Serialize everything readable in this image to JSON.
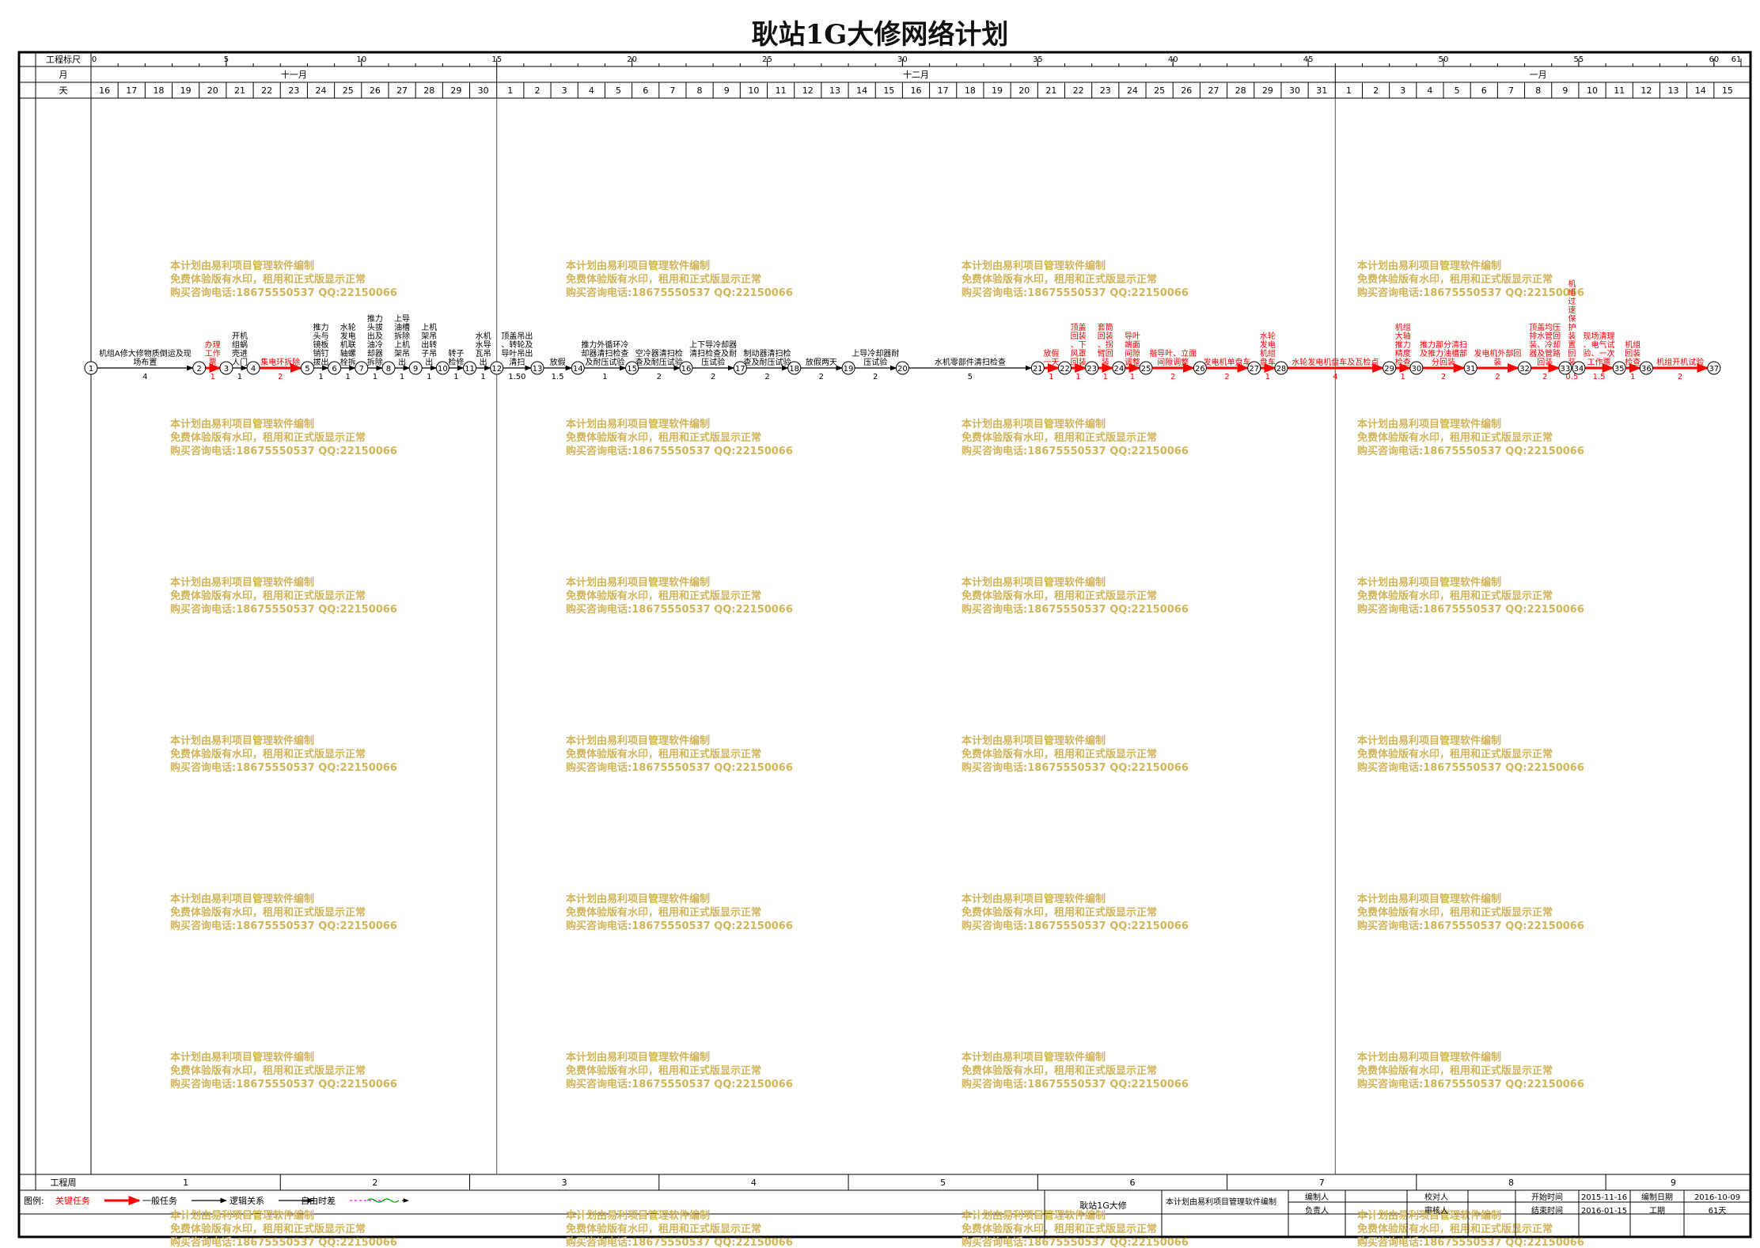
{
  "title": "耿站1G大修网络计划",
  "header": {
    "ruler_label": "工程标尺",
    "month_label": "月",
    "day_label": "天",
    "ruler_ticks": [
      {
        "label": "0",
        "t": 0
      },
      {
        "label": "5",
        "t": 5
      },
      {
        "label": "10",
        "t": 10
      },
      {
        "label": "15",
        "t": 15
      },
      {
        "label": "20",
        "t": 20
      },
      {
        "label": "25",
        "t": 25
      },
      {
        "label": "30",
        "t": 30
      },
      {
        "label": "35",
        "t": 35
      },
      {
        "label": "40",
        "t": 40
      },
      {
        "label": "45",
        "t": 45
      },
      {
        "label": "50",
        "t": 50
      },
      {
        "label": "55",
        "t": 55
      },
      {
        "label": "60",
        "t": 60
      },
      {
        "label": "61",
        "t": 61
      }
    ],
    "months": [
      {
        "label": "十一月",
        "start": 0,
        "days": 15
      },
      {
        "label": "十二月",
        "start": 15,
        "days": 31
      },
      {
        "label": "一月",
        "start": 46,
        "days": 15
      }
    ],
    "days": [
      "16",
      "17",
      "18",
      "19",
      "20",
      "21",
      "22",
      "23",
      "24",
      "25",
      "26",
      "27",
      "28",
      "29",
      "30",
      "1",
      "2",
      "3",
      "4",
      "5",
      "6",
      "7",
      "8",
      "9",
      "10",
      "11",
      "12",
      "13",
      "14",
      "15",
      "16",
      "17",
      "18",
      "19",
      "20",
      "21",
      "22",
      "23",
      "24",
      "25",
      "26",
      "27",
      "28",
      "29",
      "30",
      "31",
      "1",
      "2",
      "3",
      "4",
      "5",
      "6",
      "7",
      "8",
      "9",
      "10",
      "11",
      "12",
      "13",
      "14",
      "15"
    ]
  },
  "nodes": [
    {
      "id": "1",
      "t": 0
    },
    {
      "id": "2",
      "t": 4
    },
    {
      "id": "3",
      "t": 5
    },
    {
      "id": "4",
      "t": 6
    },
    {
      "id": "5",
      "t": 8
    },
    {
      "id": "6",
      "t": 9
    },
    {
      "id": "7",
      "t": 10
    },
    {
      "id": "8",
      "t": 11
    },
    {
      "id": "9",
      "t": 12
    },
    {
      "id": "10",
      "t": 13
    },
    {
      "id": "11",
      "t": 14
    },
    {
      "id": "12",
      "t": 15
    },
    {
      "id": "13",
      "t": 16.5
    },
    {
      "id": "14",
      "t": 18
    },
    {
      "id": "15",
      "t": 20
    },
    {
      "id": "16",
      "t": 22
    },
    {
      "id": "17",
      "t": 24
    },
    {
      "id": "18",
      "t": 26
    },
    {
      "id": "19",
      "t": 28
    },
    {
      "id": "20",
      "t": 30
    },
    {
      "id": "21",
      "t": 35
    },
    {
      "id": "22",
      "t": 36
    },
    {
      "id": "23",
      "t": 37
    },
    {
      "id": "24",
      "t": 38
    },
    {
      "id": "25",
      "t": 39
    },
    {
      "id": "26",
      "t": 41
    },
    {
      "id": "27",
      "t": 43
    },
    {
      "id": "28",
      "t": 44
    },
    {
      "id": "29",
      "t": 48
    },
    {
      "id": "30",
      "t": 49
    },
    {
      "id": "31",
      "t": 51
    },
    {
      "id": "32",
      "t": 53
    },
    {
      "id": "33",
      "t": 54.5
    },
    {
      "id": "34",
      "t": 55
    },
    {
      "id": "35",
      "t": 56.5
    },
    {
      "id": "36",
      "t": 57.5
    },
    {
      "id": "37",
      "t": 60
    }
  ],
  "tasks": [
    {
      "from": "1",
      "to": "2",
      "name": "机组A修大修物质倒运及现场布置",
      "dur": "4",
      "critical": false
    },
    {
      "from": "2",
      "to": "3",
      "name": "办理工作票",
      "dur": "1",
      "critical": true
    },
    {
      "from": "3",
      "to": "4",
      "name": "开机组蜗壳进人门",
      "dur": "1",
      "critical": false
    },
    {
      "from": "4",
      "to": "5",
      "name": "集电环拆除",
      "dur": "2",
      "critical": true
    },
    {
      "from": "5",
      "to": "6",
      "name": "推力头与镜板销钉拔出",
      "dur": "1",
      "critical": false
    },
    {
      "from": "6",
      "to": "7",
      "name": "水轮发电机联轴螺栓拆",
      "dur": "1",
      "critical": false
    },
    {
      "from": "7",
      "to": "8",
      "name": "推力头拔出及油冷却器拆除",
      "dur": "1",
      "critical": false
    },
    {
      "from": "8",
      "to": "9",
      "name": "上导油槽拆除上机架吊出",
      "dur": "1",
      "critical": false
    },
    {
      "from": "9",
      "to": "10",
      "name": "上机架吊出转子吊出",
      "dur": "1",
      "critical": false
    },
    {
      "from": "10",
      "to": "11",
      "name": "转子检修",
      "dur": "1",
      "critical": false
    },
    {
      "from": "11",
      "to": "12",
      "name": "水机水导瓦吊出",
      "dur": "1",
      "critical": false
    },
    {
      "from": "12",
      "to": "13",
      "name": "顶盖吊出、转轮及导叶吊出清扫",
      "dur": "1.50",
      "critical": false
    },
    {
      "from": "13",
      "to": "14",
      "name": "放假",
      "dur": "1.5",
      "critical": false
    },
    {
      "from": "14",
      "to": "15",
      "name": "推力外循环冷却器清扫检查及耐压试验",
      "dur": "1",
      "critical": false
    },
    {
      "from": "15",
      "to": "16",
      "name": "空冷器清扫检查及耐压试验",
      "dur": "2",
      "critical": false
    },
    {
      "from": "16",
      "to": "17",
      "name": "上下导冷却器清扫检查及耐压试验",
      "dur": "2",
      "critical": false
    },
    {
      "from": "17",
      "to": "18",
      "name": "制动器清扫检查及耐压试验",
      "dur": "2",
      "critical": false
    },
    {
      "from": "18",
      "to": "19",
      "name": "放假两天",
      "dur": "2",
      "critical": false
    },
    {
      "from": "19",
      "to": "20",
      "name": "上导冷却器耐压试验",
      "dur": "2",
      "critical": false
    },
    {
      "from": "20",
      "to": "21",
      "name": "水机零部件清扫检查",
      "dur": "5",
      "critical": false
    },
    {
      "from": "21",
      "to": "22",
      "name": "放假一天",
      "dur": "1",
      "critical": true
    },
    {
      "from": "22",
      "to": "23",
      "name": "顶盖回装、下风罩回装",
      "dur": "1",
      "critical": true
    },
    {
      "from": "23",
      "to": "24",
      "name": "套筒回装、拐臂回装",
      "dur": "1",
      "critical": true
    },
    {
      "from": "24",
      "to": "25",
      "name": "导叶端面间隙调整",
      "dur": "1",
      "critical": true
    },
    {
      "from": "25",
      "to": "26",
      "name": "揩导叶、立面间隙调整",
      "dur": "2",
      "critical": true
    },
    {
      "from": "26",
      "to": "27",
      "name": "发电机单盘车",
      "dur": "2",
      "critical": true
    },
    {
      "from": "27",
      "to": "28",
      "name": "水轮发电机组盘车",
      "dur": "1",
      "critical": true
    },
    {
      "from": "28",
      "to": "29",
      "name": "水轮发电机盘车及瓦检点",
      "dur": "4",
      "critical": true
    },
    {
      "from": "29",
      "to": "30",
      "name": "机组大轴推力精度检查",
      "dur": "1",
      "critical": true
    },
    {
      "from": "30",
      "to": "31",
      "name": "推力部分清扫及推力油槽部分回装",
      "dur": "2",
      "critical": true
    },
    {
      "from": "31",
      "to": "32",
      "name": "发电机外部回装",
      "dur": "2",
      "critical": true
    },
    {
      "from": "32",
      "to": "33",
      "name": "顶盖均压排水管回装、冷却器及管路回装",
      "dur": "2",
      "critical": true
    },
    {
      "from": "33",
      "to": "34",
      "name": "机组过速保护装置回装",
      "dur": "0.5",
      "critical": true
    },
    {
      "from": "34",
      "to": "35",
      "name": "现场清理、电气试验、一次工作票",
      "dur": "1.5",
      "critical": true
    },
    {
      "from": "35",
      "to": "36",
      "name": "机组回装检查",
      "dur": "1",
      "critical": true
    },
    {
      "from": "36",
      "to": "37",
      "name": "机组开机试验",
      "dur": "2",
      "critical": true
    }
  ],
  "footer": {
    "week_label": "工程周",
    "weeks": [
      "1",
      "2",
      "3",
      "4",
      "5",
      "6",
      "7",
      "8",
      "9"
    ],
    "legend_label": "图例:",
    "legend": [
      {
        "label": "关键任务",
        "color": "#ff0000"
      },
      {
        "label": "一般任务",
        "color": "#000000"
      },
      {
        "label": "逻辑关系",
        "color": "#000000"
      },
      {
        "label": "自由时差",
        "color": "#ff00ff"
      },
      {
        "label": "",
        "color": "#00aa00"
      }
    ],
    "project_name": "耿站1G大修",
    "note": "本计划由易利项目管理软件编制",
    "compiler_label": "编制人",
    "checker_label": "校对人",
    "owner_label": "负责人",
    "reviewer_label": "审核人",
    "start_label": "开始时间",
    "start_value": "2015-11-16",
    "end_label": "结束时间",
    "end_value": "2016-01-15",
    "date_label": "编制日期",
    "date_value": "2016-10-09",
    "duration_label": "工期",
    "duration_value": "61天"
  },
  "watermark": {
    "line1": "本计划由易利项目管理软件编制",
    "line2": "免费体验版有水印，租用和正式版显示正常",
    "line3": "购买咨询电话:18675550537 QQ:22150066",
    "color": "#d2b45a"
  },
  "colors": {
    "critical": "#ff0000",
    "normal": "#000000"
  }
}
